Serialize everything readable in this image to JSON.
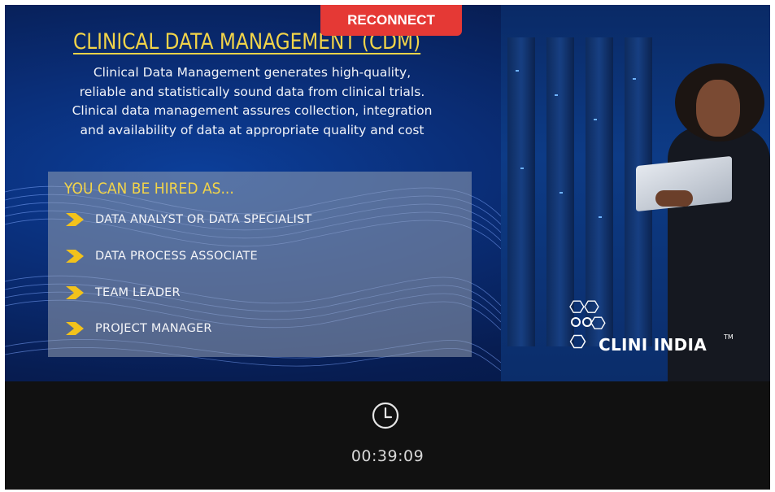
{
  "slide": {
    "title": "CLINICAL DATA MANAGEMENT (CDM)",
    "description_lines": [
      "Clinical Data Management generates high-quality,",
      "reliable and statistically sound data from clinical trials.",
      "Clinical data management assures collection, integration",
      "and availability of data at appropriate quality and cost"
    ],
    "hired_heading": "YOU CAN BE HIRED AS...",
    "jobs": [
      "DATA ANALYST OR DATA SPECIALIST",
      "DATA PROCESS ASSOCIATE",
      "TEAM LEADER",
      "PROJECT MANAGER"
    ],
    "brand": "CLINI INDIA",
    "brand_tm": "TM"
  },
  "reconnect_label": "RECONNECT",
  "player": {
    "clock_icon": "clock-icon",
    "elapsed": "00:39:09"
  },
  "colors": {
    "accent_yellow": "#f2d449",
    "reconnect_red": "#e53935",
    "slide_blue": "#0a2e78",
    "controls_bg": "#111111"
  }
}
